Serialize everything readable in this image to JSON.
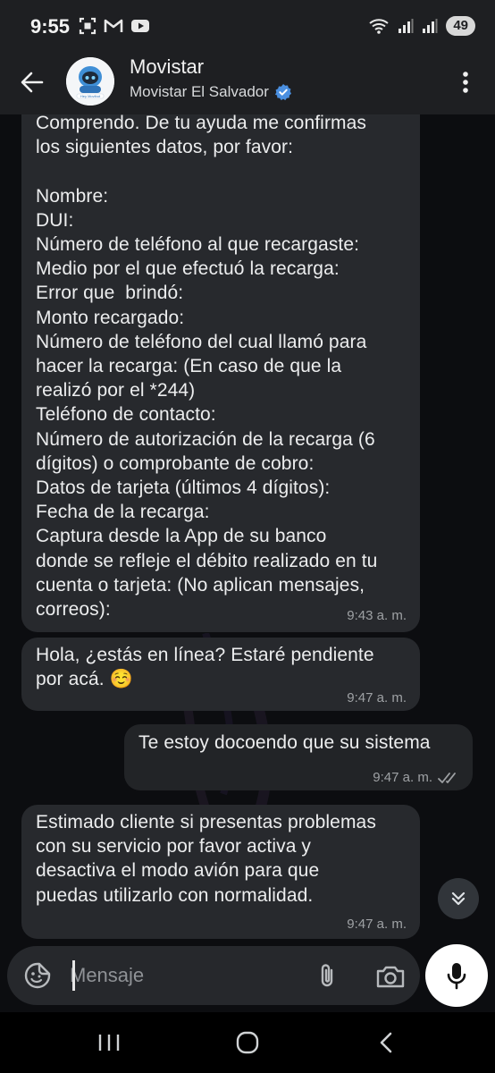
{
  "status_bar": {
    "time": "9:55",
    "battery": "49",
    "icons": [
      "screenshot-icon",
      "gmail-icon",
      "youtube-icon",
      "wifi-icon",
      "signal-icon",
      "signal-icon"
    ]
  },
  "header": {
    "contact_name": "Movistar",
    "contact_subtitle": "Movistar El Salvador",
    "verified": true,
    "avatar_label": "Hey Movibot"
  },
  "messages": [
    {
      "direction": "in",
      "text": "Comprendo. De tu ayuda me confirmas\nlos siguientes datos, por favor:\n\nNombre:\nDUI:\nNúmero de teléfono al que recargaste:\nMedio por el que efectuó la recarga:\nError que  brindó:\nMonto recargado:\nNúmero de teléfono del cual llamó para\nhacer la recarga: (En caso de que la\nrealizó por el *244)\nTeléfono de contacto:\nNúmero de autorización de la recarga (6\ndígitos) o comprobante de cobro:\nDatos de tarjeta (últimos 4 dígitos):\nFecha de la recarga:\nCaptura desde la App de su banco\ndonde se refleje el débito realizado en tu\ncuenta o tarjeta: (No aplican mensajes,\ncorreos):",
      "time": "9:43 a. m."
    },
    {
      "direction": "in",
      "text": "Hola, ¿estás en línea? Estaré pendiente\npor acá. ☺️",
      "time": "9:47 a. m."
    },
    {
      "direction": "out",
      "text": "Te estoy docoendo que su sistema",
      "time": "9:47 a. m.",
      "status": "read"
    },
    {
      "direction": "in",
      "text": "Estimado cliente si presentas problemas\ncon su servicio por favor activa y\ndesactiva el modo avión para que\npuedas utilizarlo con normalidad.",
      "time": "9:47 a. m."
    }
  ],
  "composer": {
    "placeholder": "Mensaje"
  },
  "colors": {
    "bubble_in": "#27292d",
    "bubble_out": "#222427",
    "read_ticks": "#9ea1a4",
    "verified_badge": "#4a8fe0"
  }
}
